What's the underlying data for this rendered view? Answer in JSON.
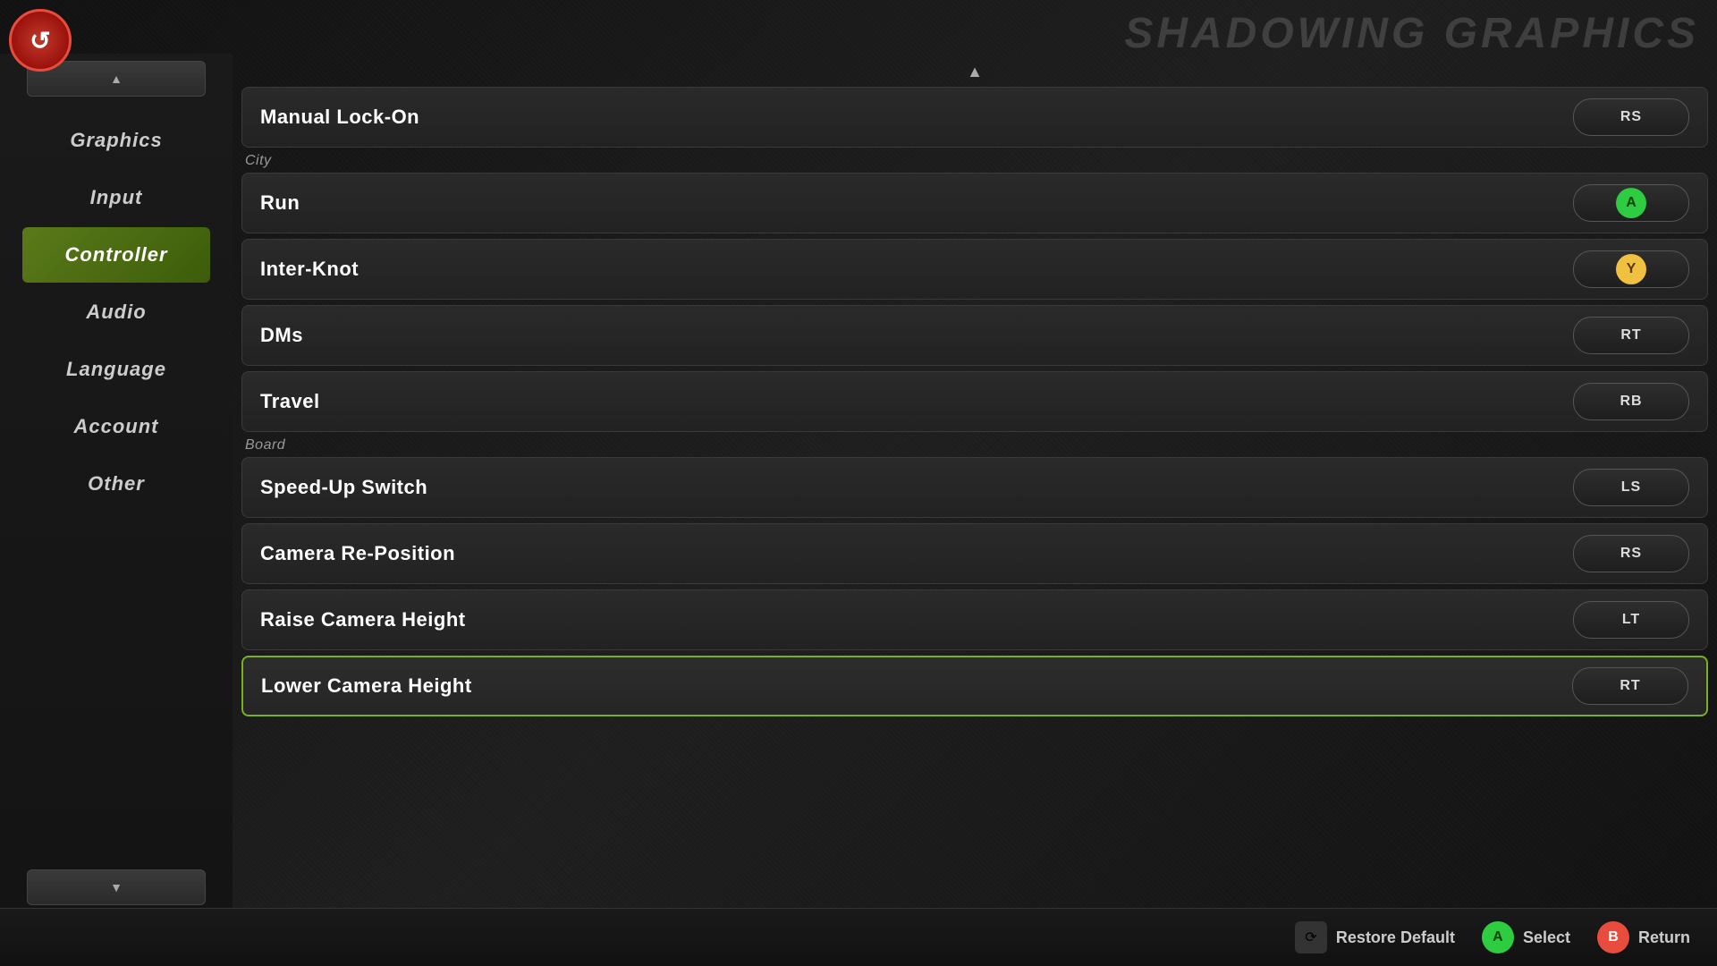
{
  "logo": {
    "symbol": "↺"
  },
  "top_right_deco": "SHADOWING GRAPHICS",
  "sidebar": {
    "scroll_up_label": "▲",
    "scroll_down_label": "▼",
    "items": [
      {
        "id": "graphics",
        "label": "Graphics",
        "active": false
      },
      {
        "id": "input",
        "label": "Input",
        "active": false
      },
      {
        "id": "controller",
        "label": "Controller",
        "active": true
      },
      {
        "id": "audio",
        "label": "Audio",
        "active": false
      },
      {
        "id": "language",
        "label": "Language",
        "active": false
      },
      {
        "id": "account",
        "label": "Account",
        "active": false
      },
      {
        "id": "other",
        "label": "Other",
        "active": false
      }
    ]
  },
  "main": {
    "scroll_up_arrow": "▲",
    "top_item": {
      "label": "Manual Lock-On",
      "button": "RS",
      "highlighted": false
    },
    "section_city": "City",
    "city_items": [
      {
        "id": "run",
        "label": "Run",
        "button": "A",
        "button_type": "circle_green",
        "highlighted": false
      },
      {
        "id": "interknot",
        "label": "Inter-Knot",
        "button": "Y",
        "button_type": "circle_yellow",
        "highlighted": false
      },
      {
        "id": "dms",
        "label": "DMs",
        "button": "RT",
        "button_type": "text",
        "highlighted": false
      },
      {
        "id": "travel",
        "label": "Travel",
        "button": "RB",
        "button_type": "text",
        "highlighted": false
      }
    ],
    "section_board": "Board",
    "board_items": [
      {
        "id": "speed_up_switch",
        "label": "Speed-Up Switch",
        "button": "LS",
        "button_type": "text",
        "highlighted": false
      },
      {
        "id": "camera_reposition",
        "label": "Camera Re-Position",
        "button": "RS",
        "button_type": "text",
        "highlighted": false
      },
      {
        "id": "raise_camera_height",
        "label": "Raise Camera Height",
        "button": "LT",
        "button_type": "text",
        "highlighted": false
      },
      {
        "id": "lower_camera_height",
        "label": "Lower Camera Height",
        "button": "RT",
        "button_type": "text",
        "highlighted": true
      }
    ]
  },
  "bottom": {
    "restore_icon": "⟳",
    "restore_label": "Restore Default",
    "select_icon": "A",
    "select_label": "Select",
    "return_icon": "B",
    "return_label": "Return"
  }
}
